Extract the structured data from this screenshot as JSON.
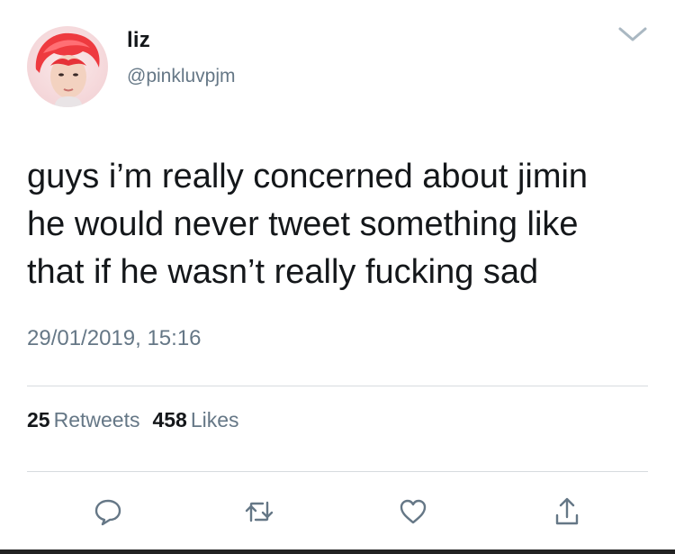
{
  "user": {
    "display_name": "liz",
    "handle": "@pinkluvpjm",
    "avatar_icon": "profile-photo"
  },
  "header": {
    "menu_icon": "chevron-down-icon"
  },
  "tweet": {
    "text": "guys i’m really concerned about jimin\nhe would never tweet something like\nthat if he wasn’t really fucking sad",
    "timestamp": "29/01/2019, 15:16"
  },
  "stats": {
    "retweets_count": "25",
    "retweets_label": "Retweets",
    "likes_count": "458",
    "likes_label": "Likes"
  },
  "actions": [
    {
      "icon": "reply-icon"
    },
    {
      "icon": "retweet-icon"
    },
    {
      "icon": "like-icon"
    },
    {
      "icon": "share-icon"
    }
  ],
  "colors": {
    "text": "#14171a",
    "secondary": "#657786",
    "divider": "#d7dbdf",
    "icon": "#657786"
  }
}
